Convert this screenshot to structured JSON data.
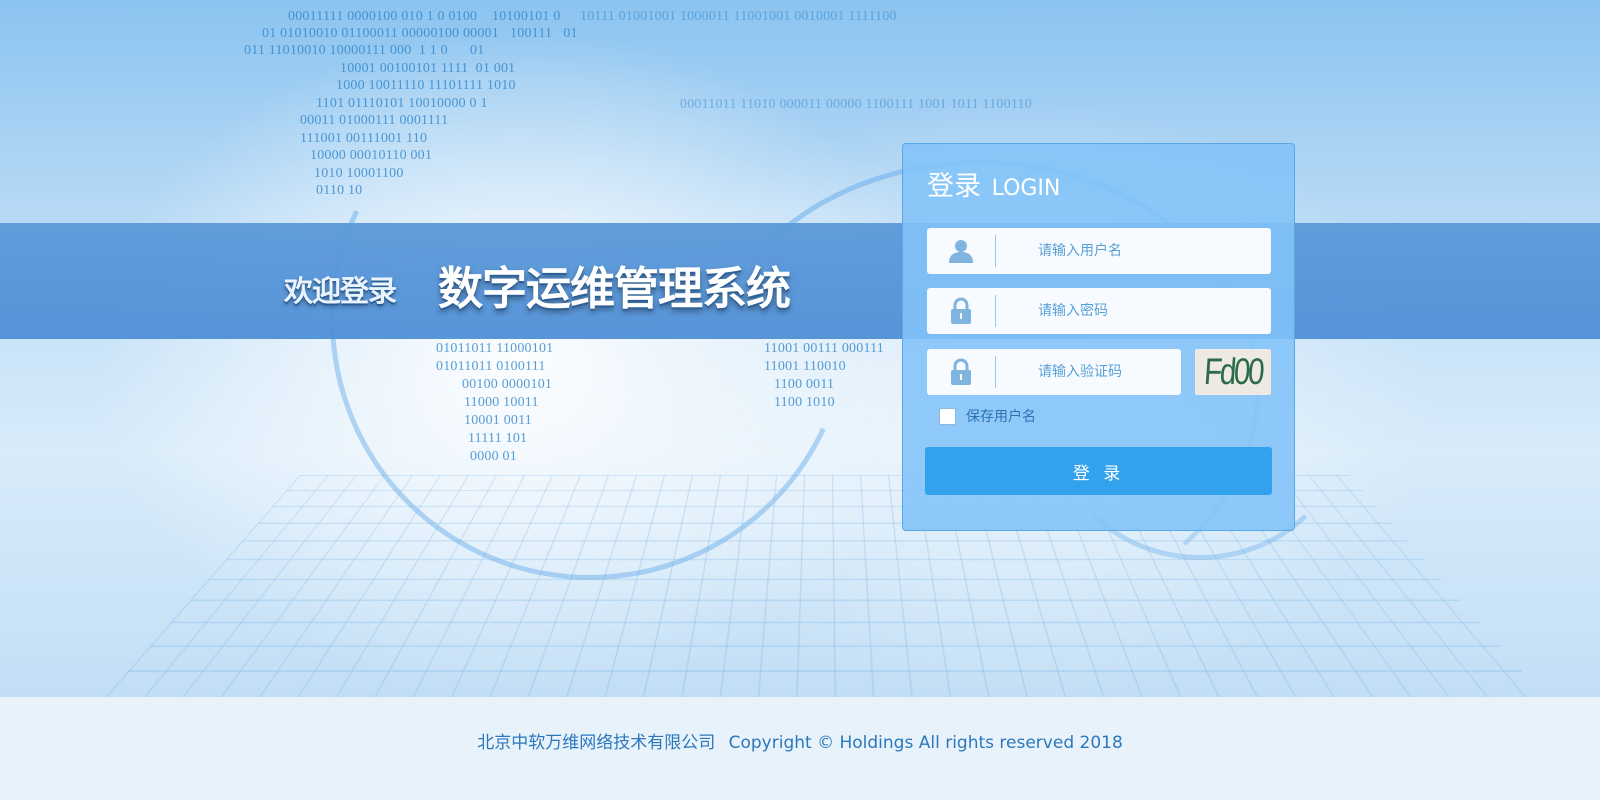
{
  "banner": {
    "welcome": "欢迎登录",
    "system_title": "数字运维管理系统"
  },
  "login": {
    "title_cn": "登录",
    "title_en": "LOGIN",
    "username_placeholder": "请输入用户名",
    "password_placeholder": "请输入密码",
    "captcha_placeholder": "请输入验证码",
    "captcha_code": "Fd00",
    "remember_label": "保存用户名",
    "remember_checked": false,
    "submit_label": "登 录"
  },
  "icons": {
    "username": "user-icon",
    "password": "lock-icon",
    "captcha": "lock-icon"
  },
  "background_binary": [
    "00011111 0000100 010 1 0 0100    10100101 0",
    "01 01010010 01100011 00000100 00001   100111   01",
    "011 11010010 10000111 000  1 1 0      01",
    "10001 00100101 1111  01 001",
    "1000 10011110 11101111 1010",
    "1101 01110101 10010000 0 1",
    "00011 01000111 0001111",
    "111001 00111001 110",
    "10000 00010110 001",
    "1010 10001100",
    "0110 10",
    "10111 01001001 1000011 11001001 0010001 1111100",
    "00011011 11010 000011 00000 1100111 1001 1011 1100110",
    "01011011 11000101",
    "01011011 0100111",
    "00100 0000101",
    "11000 10011",
    "10001 0011",
    "11111 101",
    "0000 01",
    "11001 00111 000111",
    "11001 110010",
    "1100 0011",
    "1100 1010"
  ],
  "footer": {
    "company": "北京中软万维网络技术有限公司",
    "copyright": "Copyright © Holdings All rights reserved 2018"
  },
  "colors": {
    "band": "#4f8fd6",
    "panel": "#82c3f8",
    "button": "#32a2ee",
    "footer_text": "#2b78bd"
  }
}
